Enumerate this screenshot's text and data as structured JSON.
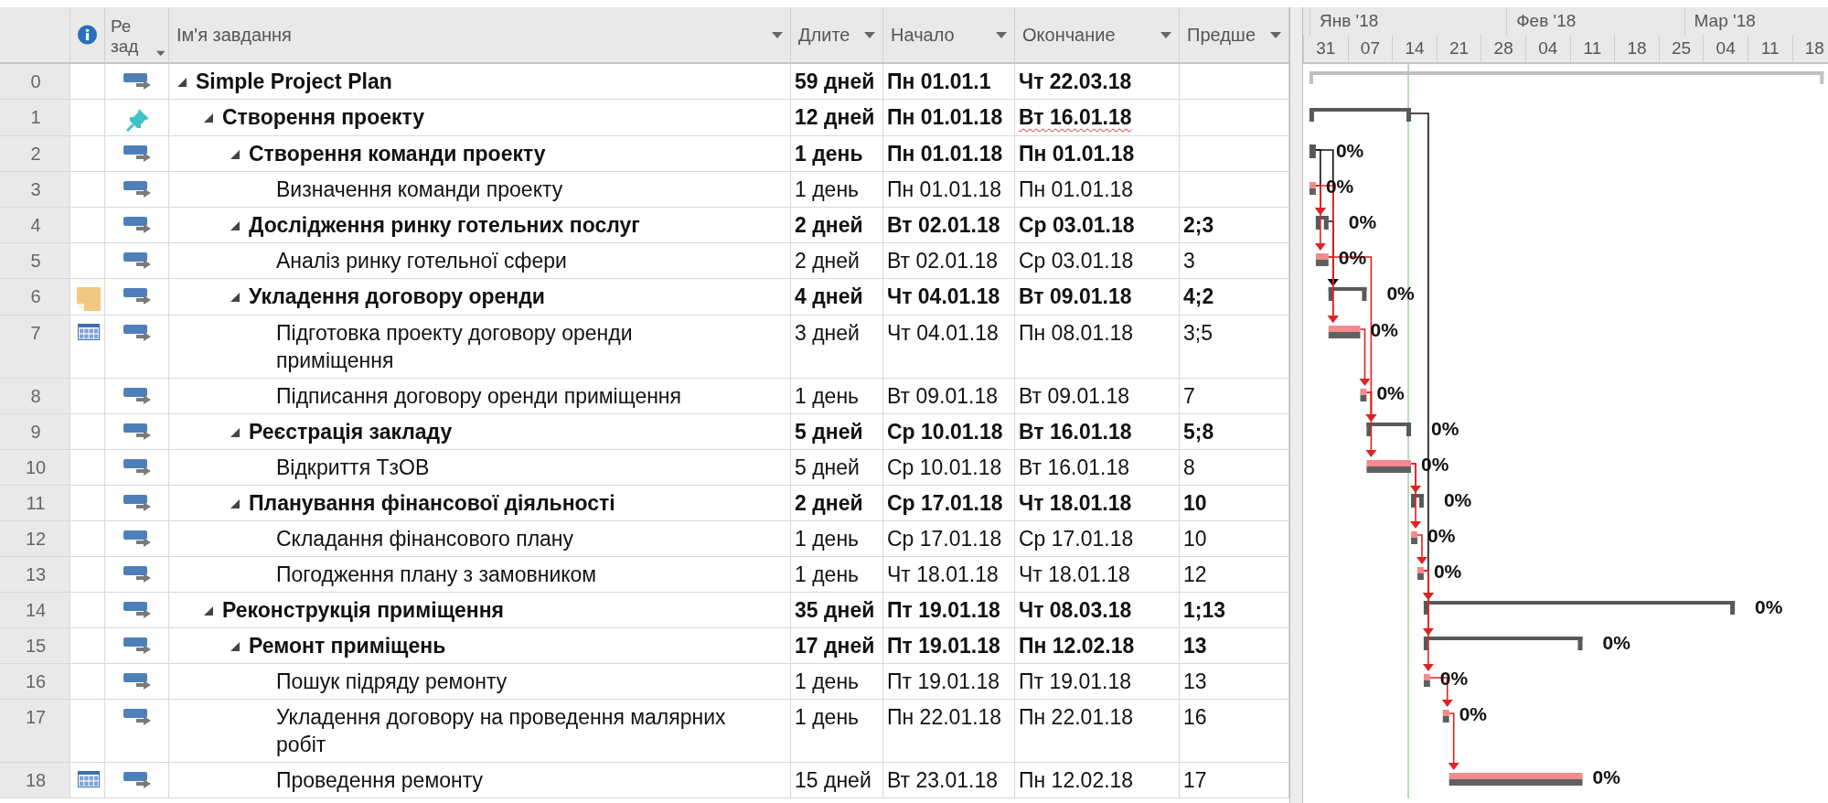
{
  "table": {
    "columns": [
      {
        "kind": "info",
        "dropdown": false
      },
      {
        "kind": "mode",
        "label": "Ре зад",
        "dropdown": true
      },
      {
        "kind": "name",
        "label": "Ім'я завдання",
        "dropdown": true
      },
      {
        "kind": "duration",
        "label": "Длите",
        "dropdown": true
      },
      {
        "kind": "start",
        "label": "Начало",
        "dropdown": true
      },
      {
        "kind": "finish",
        "label": "Окончание",
        "dropdown": true
      },
      {
        "kind": "predecessors",
        "label": "Предше",
        "dropdown": true
      }
    ]
  },
  "timescale": {
    "months": [
      "Янв '18",
      "Фев '18",
      "Мар '18"
    ],
    "weeks": [
      "31",
      "07",
      "14",
      "21",
      "28",
      "04",
      "11",
      "18",
      "25",
      "04",
      "11",
      "18"
    ]
  },
  "tasks": [
    {
      "id": "0",
      "name": "Simple Project Plan",
      "kind": "project",
      "manually_scheduled": false,
      "expanded": true,
      "duration": "59 дней",
      "start": "Пн 01.01.1",
      "finish": "Чт 22.03.18",
      "children": [
        {
          "id": "1",
          "name": "Створення проекту",
          "kind": "summary",
          "manually_scheduled": true,
          "expanded": true,
          "duration": "12 дней",
          "start": "Пн 01.01.18",
          "finish": "Вт 16.01.18",
          "finish_flagged": true,
          "children": [
            {
              "id": "2",
              "name": "Створення команди проекту",
              "kind": "summary",
              "manually_scheduled": false,
              "expanded": true,
              "duration": "1 день",
              "start": "Пн 01.01.18",
              "finish": "Пн 01.01.18",
              "progress": "0%",
              "children": [
                {
                  "id": "3",
                  "name": "Визначення команди проекту",
                  "kind": "task",
                  "manually_scheduled": false,
                  "duration": "1 день",
                  "start": "Пн 01.01.18",
                  "finish": "Пн 01.01.18",
                  "progress": "0%"
                }
              ]
            },
            {
              "id": "4",
              "name": "Дослідження ринку готельних послуг",
              "kind": "summary",
              "manually_scheduled": false,
              "expanded": true,
              "duration": "2 дней",
              "start": "Вт 02.01.18",
              "finish": "Ср 03.01.18",
              "predecessors": "2;3",
              "progress": "0%",
              "children": [
                {
                  "id": "5",
                  "name": "Аналіз ринку готельної сфери",
                  "kind": "task",
                  "manually_scheduled": false,
                  "duration": "2 дней",
                  "start": "Вт 02.01.18",
                  "finish": "Ср 03.01.18",
                  "predecessors": "3",
                  "progress": "0%"
                }
              ]
            },
            {
              "id": "6",
              "name": "Укладення договору оренди",
              "kind": "summary",
              "manually_scheduled": false,
              "indicators": [
                {
                  "kind": "note"
                }
              ],
              "expanded": true,
              "duration": "4 дней",
              "start": "Чт 04.01.18",
              "finish": "Вт 09.01.18",
              "predecessors": "4;2",
              "progress": "0%",
              "children": [
                {
                  "id": "7",
                  "name": "Підготовка проекту договору оренди приміщення",
                  "kind": "task",
                  "manually_scheduled": false,
                  "indicators": [
                    {
                      "kind": "calendar"
                    }
                  ],
                  "duration": "3 дней",
                  "start": "Чт 04.01.18",
                  "finish": "Пн 08.01.18",
                  "predecessors": "3;5",
                  "progress": "0%"
                },
                {
                  "id": "8",
                  "name": "Підписання договору оренди приміщення",
                  "kind": "task",
                  "manually_scheduled": false,
                  "duration": "1 день",
                  "start": "Вт 09.01.18",
                  "finish": "Вт 09.01.18",
                  "predecessors": "7",
                  "progress": "0%"
                }
              ]
            },
            {
              "id": "9",
              "name": "Реєстрація закладу",
              "kind": "summary",
              "manually_scheduled": false,
              "expanded": true,
              "duration": "5 дней",
              "start": "Ср 10.01.18",
              "finish": "Вт 16.01.18",
              "predecessors": "5;8",
              "progress": "0%",
              "children": [
                {
                  "id": "10",
                  "name": "Відкриття ТзОВ",
                  "kind": "task",
                  "manually_scheduled": false,
                  "duration": "5 дней",
                  "start": "Ср 10.01.18",
                  "finish": "Вт 16.01.18",
                  "predecessors": "8",
                  "progress": "0%"
                }
              ]
            },
            {
              "id": "11",
              "name": "Планування фінансової діяльності",
              "kind": "summary",
              "manually_scheduled": false,
              "expanded": true,
              "duration": "2 дней",
              "start": "Ср 17.01.18",
              "finish": "Чт 18.01.18",
              "predecessors": "10",
              "progress": "0%",
              "children": [
                {
                  "id": "12",
                  "name": "Складання фінансового плану",
                  "kind": "task",
                  "manually_scheduled": false,
                  "duration": "1 день",
                  "start": "Ср 17.01.18",
                  "finish": "Ср 17.01.18",
                  "predecessors": "10",
                  "progress": "0%"
                },
                {
                  "id": "13",
                  "name": "Погодження плану з замовником",
                  "kind": "task",
                  "manually_scheduled": false,
                  "duration": "1 день",
                  "start": "Чт 18.01.18",
                  "finish": "Чт 18.01.18",
                  "predecessors": "12",
                  "progress": "0%"
                }
              ]
            }
          ]
        },
        {
          "id": "14",
          "name": "Реконструкція приміщення",
          "kind": "summary",
          "manually_scheduled": false,
          "expanded": true,
          "duration": "35 дней",
          "start": "Пт 19.01.18",
          "finish": "Чт 08.03.18",
          "predecessors": "1;13",
          "progress": "0%",
          "children": [
            {
              "id": "15",
              "name": "Ремонт приміщень",
              "kind": "summary",
              "manually_scheduled": false,
              "expanded": true,
              "duration": "17 дней",
              "start": "Пт 19.01.18",
              "finish": "Пн 12.02.18",
              "predecessors": "13",
              "progress": "0%",
              "children": [
                {
                  "id": "16",
                  "name": "Пошук підряду ремонту",
                  "kind": "task",
                  "manually_scheduled": false,
                  "duration": "1 день",
                  "start": "Пт 19.01.18",
                  "finish": "Пт 19.01.18",
                  "predecessors": "13",
                  "progress": "0%"
                },
                {
                  "id": "17",
                  "name": "Укладення договору на проведення малярних робіт",
                  "kind": "task",
                  "manually_scheduled": false,
                  "duration": "1 день",
                  "start": "Пн 22.01.18",
                  "finish": "Пн 22.01.18",
                  "predecessors": "16",
                  "progress": "0%"
                },
                {
                  "id": "18",
                  "name": "Проведення ремонту",
                  "kind": "task",
                  "manually_scheduled": false,
                  "indicators": [
                    {
                      "kind": "calendar"
                    }
                  ],
                  "duration": "15 дней",
                  "start": "Вт 23.01.18",
                  "finish": "Пн 12.02.18",
                  "predecessors": "17",
                  "progress": "0%"
                }
              ]
            }
          ]
        }
      ]
    }
  ]
}
